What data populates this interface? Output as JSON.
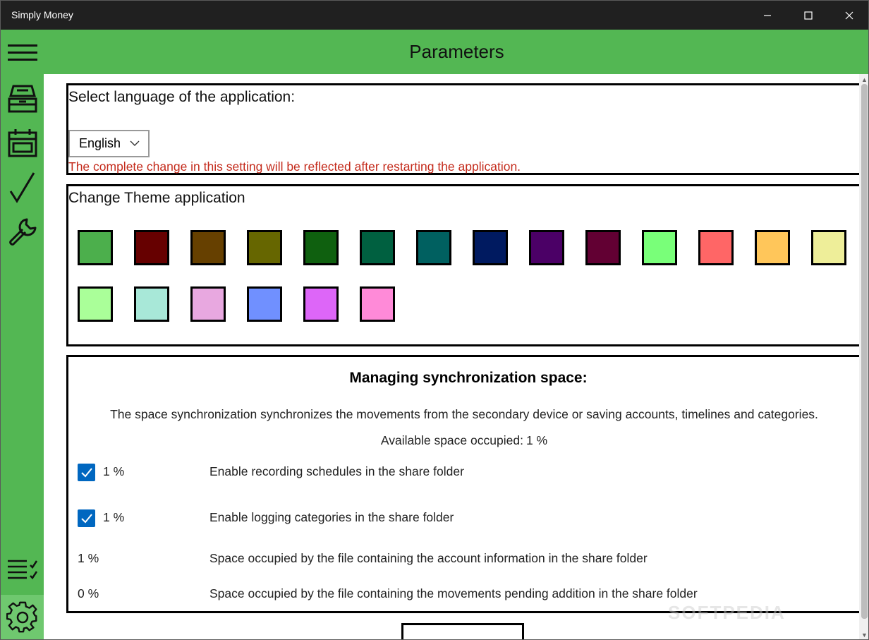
{
  "window": {
    "title": "Simply Money",
    "controls": {
      "minimize": "—",
      "maximize": "☐",
      "close": "✕"
    }
  },
  "sidebar": {
    "items": [
      {
        "name": "menu",
        "icon": "hamburger-menu-icon"
      },
      {
        "name": "accounts",
        "icon": "store-icon"
      },
      {
        "name": "schedules",
        "icon": "calendar-icon"
      },
      {
        "name": "reconcile",
        "icon": "checkmark-icon"
      },
      {
        "name": "tools",
        "icon": "wrench-icon"
      },
      {
        "name": "tasks",
        "icon": "checklist-icon"
      },
      {
        "name": "parameters",
        "icon": "gear-icon",
        "selected": true
      }
    ],
    "color": "#53b753",
    "selected_color": "#6fc86f"
  },
  "header": {
    "title": "Parameters"
  },
  "language": {
    "title": "Select language of the application:",
    "selected": "English",
    "warning": "The complete change in this setting will be reflected after restarting the application."
  },
  "theme": {
    "title": "Change Theme application",
    "colors": [
      "#4caf4c",
      "#660000",
      "#664000",
      "#666600",
      "#0f600f",
      "#006040",
      "#006060",
      "#001a60",
      "#4b0066",
      "#620033",
      "#79ff79",
      "#ff6666",
      "#ffc65a",
      "#eeee99",
      "#aaff99",
      "#a8e8d8",
      "#e8a8e0",
      "#7090ff",
      "#dd66f8",
      "#ff8ad8"
    ]
  },
  "sync": {
    "title": "Managing synchronization space:",
    "description": "The space synchronization synchronizes the movements from the secondary device or saving accounts, timelines and categories.",
    "available_label": "Available space occupied:",
    "available_value": "1 %",
    "rows": [
      {
        "checked": true,
        "percent": "1 %",
        "label": "Enable recording schedules in the share folder"
      },
      {
        "checked": true,
        "percent": "1 %",
        "label": "Enable logging categories in the share folder"
      },
      {
        "percent": "1 %",
        "label": "Space occupied by the file containing the account information in the share folder"
      },
      {
        "percent": "0 %",
        "label": "Space occupied by the file containing the movements pending addition in the share folder"
      }
    ]
  },
  "watermark": "SOFTPEDIA"
}
